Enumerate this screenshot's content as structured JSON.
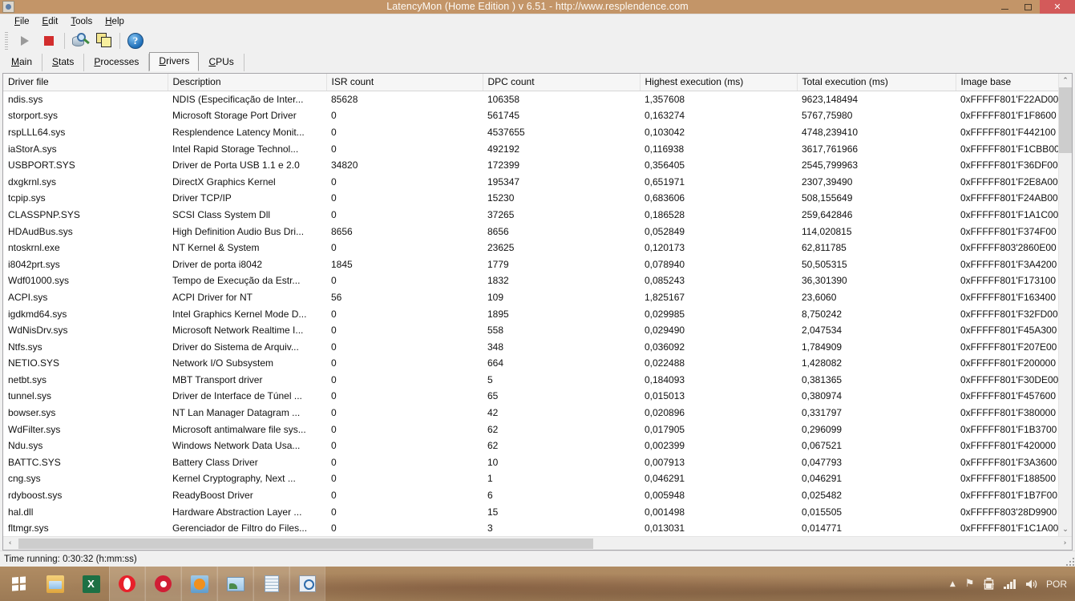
{
  "window": {
    "title": "LatencyMon  (Home Edition )  v 6.51 - http://www.resplendence.com",
    "icon": "latencymon-icon",
    "controls": {
      "minimize": "—",
      "maximize": "□",
      "close": "✕"
    }
  },
  "menubar": [
    {
      "label": "File",
      "accel": "F"
    },
    {
      "label": "Edit",
      "accel": "E"
    },
    {
      "label": "Tools",
      "accel": "T"
    },
    {
      "label": "Help",
      "accel": "H"
    }
  ],
  "toolbar": {
    "buttons": [
      {
        "name": "start-monitoring-button",
        "icon": "play-icon",
        "enabled": false
      },
      {
        "name": "stop-monitoring-button",
        "icon": "stop-icon",
        "enabled": true
      },
      {
        "name": "analyze-button",
        "icon": "magnifier-disk-icon",
        "enabled": true
      },
      {
        "name": "copy-report-button",
        "icon": "copy-pages-icon",
        "enabled": true
      },
      {
        "name": "help-button",
        "icon": "help-question-icon",
        "enabled": true,
        "glyph": "?"
      }
    ]
  },
  "tabs": [
    {
      "label": "Main",
      "accel": "M",
      "active": false
    },
    {
      "label": "Stats",
      "accel": "S",
      "active": false
    },
    {
      "label": "Processes",
      "accel": "P",
      "active": false
    },
    {
      "label": "Drivers",
      "accel": "D",
      "active": true
    },
    {
      "label": "CPUs",
      "accel": "C",
      "active": false
    }
  ],
  "table": {
    "columns": [
      "Driver file",
      "Description",
      "ISR count",
      "DPC count",
      "Highest execution (ms)",
      "Total execution (ms)",
      "Image base"
    ],
    "rows": [
      [
        "ndis.sys",
        "NDIS (Especificação de Inter...",
        "85628",
        "106358",
        "1,357608",
        "9623,148494",
        "0xFFFFF801'F22AD00"
      ],
      [
        "storport.sys",
        "Microsoft Storage Port Driver",
        "0",
        "561745",
        "0,163274",
        "5767,75980",
        "0xFFFFF801'F1F8600"
      ],
      [
        "rspLLL64.sys",
        "Resplendence Latency Monit...",
        "0",
        "4537655",
        "0,103042",
        "4748,239410",
        "0xFFFFF801'F442100"
      ],
      [
        "iaStorA.sys",
        "Intel Rapid Storage Technol...",
        "0",
        "492192",
        "0,116938",
        "3617,761966",
        "0xFFFFF801'F1CBB00"
      ],
      [
        "USBPORT.SYS",
        "Driver de Porta USB 1.1 e 2.0",
        "34820",
        "172399",
        "0,356405",
        "2545,799963",
        "0xFFFFF801'F36DF00"
      ],
      [
        "dxgkrnl.sys",
        "DirectX Graphics Kernel",
        "0",
        "195347",
        "0,651971",
        "2307,39490",
        "0xFFFFF801'F2E8A00"
      ],
      [
        "tcpip.sys",
        "Driver TCP/IP",
        "0",
        "15230",
        "0,683606",
        "508,155649",
        "0xFFFFF801'F24AB00"
      ],
      [
        "CLASSPNP.SYS",
        "SCSI Class System Dll",
        "0",
        "37265",
        "0,186528",
        "259,642846",
        "0xFFFFF801'F1A1C00"
      ],
      [
        "HDAudBus.sys",
        "High Definition Audio Bus Dri...",
        "8656",
        "8656",
        "0,052849",
        "114,020815",
        "0xFFFFF801'F374F00"
      ],
      [
        "ntoskrnl.exe",
        "NT Kernel & System",
        "0",
        "23625",
        "0,120173",
        "62,811785",
        "0xFFFFF803'2860E00"
      ],
      [
        "i8042prt.sys",
        "Driver de porta i8042",
        "1845",
        "1779",
        "0,078940",
        "50,505315",
        "0xFFFFF801'F3A4200"
      ],
      [
        "Wdf01000.sys",
        "Tempo de Execução da Estr...",
        "0",
        "1832",
        "0,085243",
        "36,301390",
        "0xFFFFF801'F173100"
      ],
      [
        "ACPI.sys",
        "ACPI Driver for NT",
        "56",
        "109",
        "1,825167",
        "23,6060",
        "0xFFFFF801'F163400"
      ],
      [
        "igdkmd64.sys",
        "Intel Graphics Kernel Mode D...",
        "0",
        "1895",
        "0,029985",
        "8,750242",
        "0xFFFFF801'F32FD00"
      ],
      [
        "WdNisDrv.sys",
        "Microsoft Network Realtime I...",
        "0",
        "558",
        "0,029490",
        "2,047534",
        "0xFFFFF801'F45A300"
      ],
      [
        "Ntfs.sys",
        "Driver do Sistema de Arquiv...",
        "0",
        "348",
        "0,036092",
        "1,784909",
        "0xFFFFF801'F207E00"
      ],
      [
        "NETIO.SYS",
        "Network I/O Subsystem",
        "0",
        "664",
        "0,022488",
        "1,428082",
        "0xFFFFF801'F200000"
      ],
      [
        "netbt.sys",
        "MBT Transport driver",
        "0",
        "5",
        "0,184093",
        "0,381365",
        "0xFFFFF801'F30DE00"
      ],
      [
        "tunnel.sys",
        "Driver de Interface de Túnel ...",
        "0",
        "65",
        "0,015013",
        "0,380974",
        "0xFFFFF801'F457600"
      ],
      [
        "bowser.sys",
        "NT Lan Manager Datagram ...",
        "0",
        "42",
        "0,020896",
        "0,331797",
        "0xFFFFF801'F380000"
      ],
      [
        "WdFilter.sys",
        "Microsoft antimalware file sys...",
        "0",
        "62",
        "0,017905",
        "0,296099",
        "0xFFFFF801'F1B3700"
      ],
      [
        "Ndu.sys",
        "Windows Network Data Usa...",
        "0",
        "62",
        "0,002399",
        "0,067521",
        "0xFFFFF801'F420000"
      ],
      [
        "BATTC.SYS",
        "Battery Class Driver",
        "0",
        "10",
        "0,007913",
        "0,047793",
        "0xFFFFF801'F3A3600"
      ],
      [
        "cng.sys",
        "Kernel Cryptography, Next ...",
        "0",
        "1",
        "0,046291",
        "0,046291",
        "0xFFFFF801'F188500"
      ],
      [
        "rdyboost.sys",
        "ReadyBoost Driver",
        "0",
        "6",
        "0,005948",
        "0,025482",
        "0xFFFFF801'F1B7F00"
      ],
      [
        "hal.dll",
        "Hardware Abstraction Layer ...",
        "0",
        "15",
        "0,001498",
        "0,015505",
        "0xFFFFF803'28D9900"
      ],
      [
        "fltmgr.sys",
        "Gerenciador de Filtro do Files...",
        "0",
        "3",
        "0,013031",
        "0,014771",
        "0xFFFFF801'F1C1A00"
      ]
    ]
  },
  "scrollbars": {
    "up_arrow": "⌃",
    "down_arrow": "⌄",
    "left_arrow": "‹",
    "right_arrow": "›"
  },
  "statusbar": {
    "text": "Time running: 0:30:32  (h:mm:ss)"
  },
  "taskbar": {
    "start": "start-button",
    "items": [
      {
        "name": "taskbar-item-explorer",
        "icon": "file-explorer-icon",
        "open": false
      },
      {
        "name": "taskbar-item-excel",
        "icon": "excel-icon",
        "glyph": "X",
        "open": false
      },
      {
        "name": "taskbar-item-opera",
        "icon": "opera-icon",
        "open": true
      },
      {
        "name": "taskbar-item-recorder",
        "icon": "record-circle-icon",
        "open": true
      },
      {
        "name": "taskbar-item-vlc",
        "icon": "media-player-icon",
        "open": true
      },
      {
        "name": "taskbar-item-photos",
        "icon": "photo-viewer-icon",
        "open": true
      },
      {
        "name": "taskbar-item-notepad",
        "icon": "notepad-icon",
        "open": true
      },
      {
        "name": "taskbar-item-latencymon",
        "icon": "latencymon-icon",
        "open": true
      }
    ],
    "tray": {
      "show_hidden": "▲",
      "flag": "⚑",
      "battery": "battery-icon",
      "network": "signal-bars-icon",
      "volume": "🔊",
      "language": "POR"
    }
  },
  "colors": {
    "titlebar": "#c39568",
    "close_button": "#d35a5a",
    "window_face": "#f0f0f0",
    "grid_background": "#ffffff",
    "accent_stop": "#d22d2d",
    "taskbar": "#9c7a55"
  }
}
